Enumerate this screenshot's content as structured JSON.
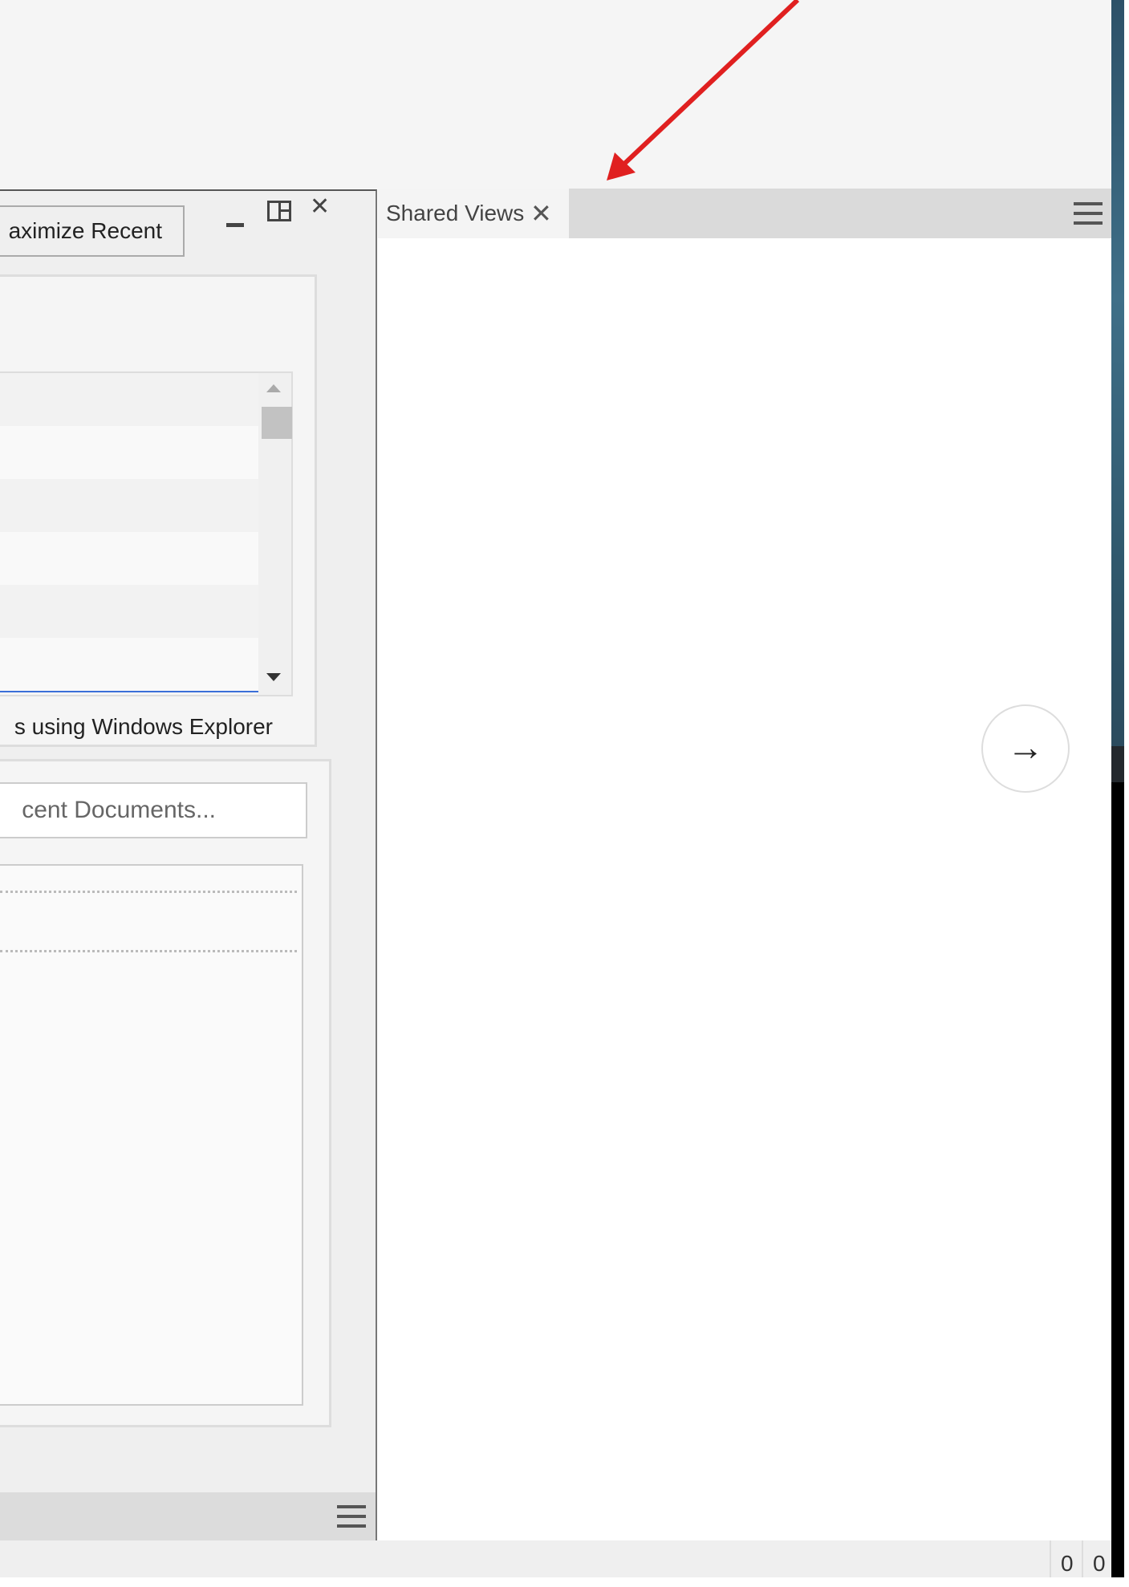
{
  "left_panel": {
    "maximize_button": "aximize Recent",
    "explorer_text": "s using Windows Explorer",
    "search_placeholder": "cent Documents...",
    "icons": {
      "minimize": "minimize-icon",
      "restore": "restore-icon",
      "close": "close-icon",
      "menu": "hamburger-icon"
    }
  },
  "right_panel": {
    "tab_label": "Shared Views",
    "tab_close": "✕",
    "next_arrow": "→"
  },
  "status_bar": {
    "values": [
      "0",
      "0"
    ]
  },
  "annotation_color": "#e02020"
}
